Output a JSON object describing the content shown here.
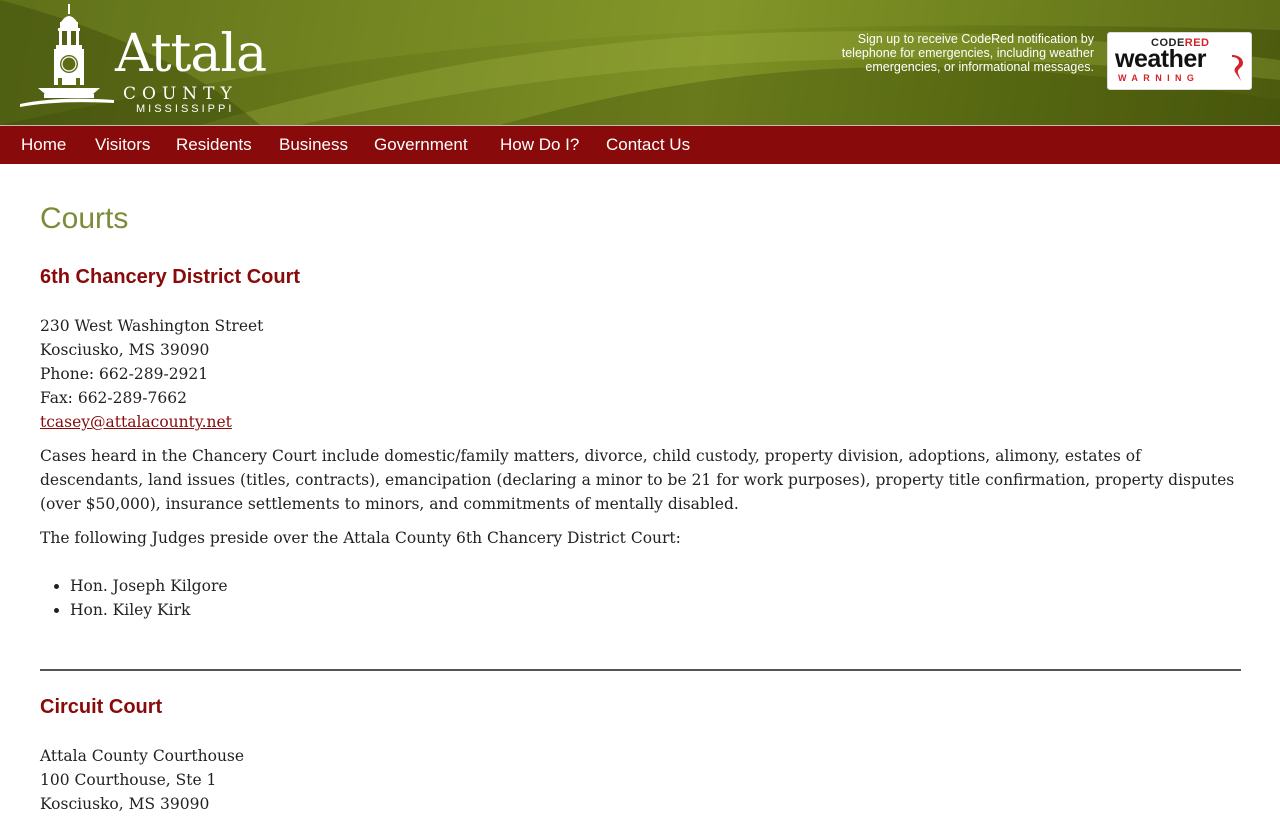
{
  "header": {
    "logo": {
      "word": "Attala",
      "county": "COUNTY",
      "state": "MISSISSIPPI"
    },
    "codered_text": "Sign up to receive CodeRed notification by telephone for emergencies, including weather emergencies, or informational messages.",
    "badge": {
      "code": "CODE",
      "red": "RED",
      "weather": "weather",
      "warning": "WARNING"
    }
  },
  "nav": {
    "items": [
      "Home",
      "Visitors",
      "Residents",
      "Business",
      "Government",
      "How Do I?",
      "Contact Us"
    ]
  },
  "page": {
    "title": "Courts",
    "chancery": {
      "heading": "6th Chancery District Court",
      "address1": "230 West Washington Street",
      "address2": "Kosciusko, MS 39090",
      "phone": "Phone:  662-289-2921",
      "fax": "Fax:  662-289-7662",
      "email": "tcasey@attalacounty.net",
      "description": "Cases heard in the Chancery Court include domestic/family matters, divorce, child custody, property division, adoptions, alimony, estates of descendants, land issues (titles, contracts), emancipation (declaring a minor to be 21 for work purposes), property title confirmation, property disputes (over $50,000), insurance settlements to minors, and commitments of mentally disabled.",
      "judges_intro": "The following Judges preside over the Attala County 6th Chancery District Court:",
      "judges": [
        "Hon. Joseph Kilgore",
        "Hon. Kiley Kirk"
      ]
    },
    "circuit": {
      "heading": "Circuit Court",
      "address1": "Attala County Courthouse",
      "address2": "100 Courthouse, Ste 1",
      "address3": "Kosciusko, MS 39090"
    }
  },
  "colors": {
    "nav_bg": "#890a0a",
    "title": "#7a8c38",
    "heading": "#890a0a",
    "header_green": "#6b7d1c"
  }
}
